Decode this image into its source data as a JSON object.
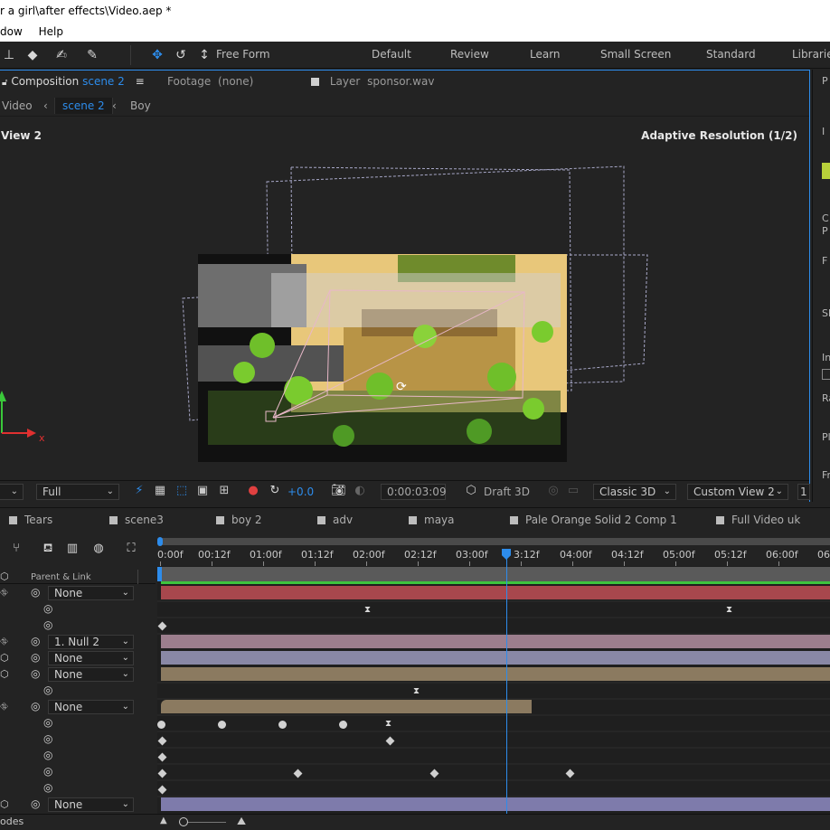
{
  "window": {
    "title": "r a girl\\after effects\\Video.aep *"
  },
  "menu": {
    "items": [
      "dow",
      "Help"
    ]
  },
  "toolbar": {
    "free_form_label": "Free Form",
    "workspaces": [
      "Default",
      "Review",
      "Learn",
      "Small Screen",
      "Standard",
      "Libraries"
    ]
  },
  "comp_panel": {
    "composition_prefix": "Composition",
    "composition_name": "scene 2",
    "footage_label": "Footage",
    "footage_value": "(none)",
    "layer_label": "Layer",
    "layer_value": "sponsor.wav",
    "breadcrumbs": [
      "Video",
      "scene 2",
      "Boy"
    ],
    "view_label": "View 2",
    "adaptive_label": "Adaptive Resolution (1/2)"
  },
  "viewer_bar": {
    "resolution": "Full",
    "exposure": "+0.0",
    "timecode": "0:00:03:09",
    "draft3d": "Draft 3D",
    "renderer": "Classic 3D",
    "view": "Custom View 2"
  },
  "timeline": {
    "tabs": [
      "Tears",
      "scene3",
      "boy 2",
      "adv",
      "maya",
      "Pale Orange Solid 2 Comp 1",
      "Full Video uk"
    ],
    "column_header": "Parent & Link",
    "ruler_labels": [
      "0:00f",
      "00:12f",
      "01:00f",
      "01:12f",
      "02:00f",
      "02:12f",
      "03:00f",
      "3:12f",
      "04:00f",
      "04:12f",
      "05:00f",
      "05:12f",
      "06:00f",
      "06"
    ],
    "current_time_fraction": 0.519,
    "parents": [
      "None",
      "1. Null 2",
      "None",
      "None",
      "None",
      "None"
    ],
    "layer_colors": {
      "red": "#a8474d",
      "mauve": "#9c7e8d",
      "lavender": "#8988a6",
      "tan": "#8b7a60",
      "purple": "#7e7bab"
    }
  },
  "bottom_bar": {
    "toggle_label": "odes"
  }
}
